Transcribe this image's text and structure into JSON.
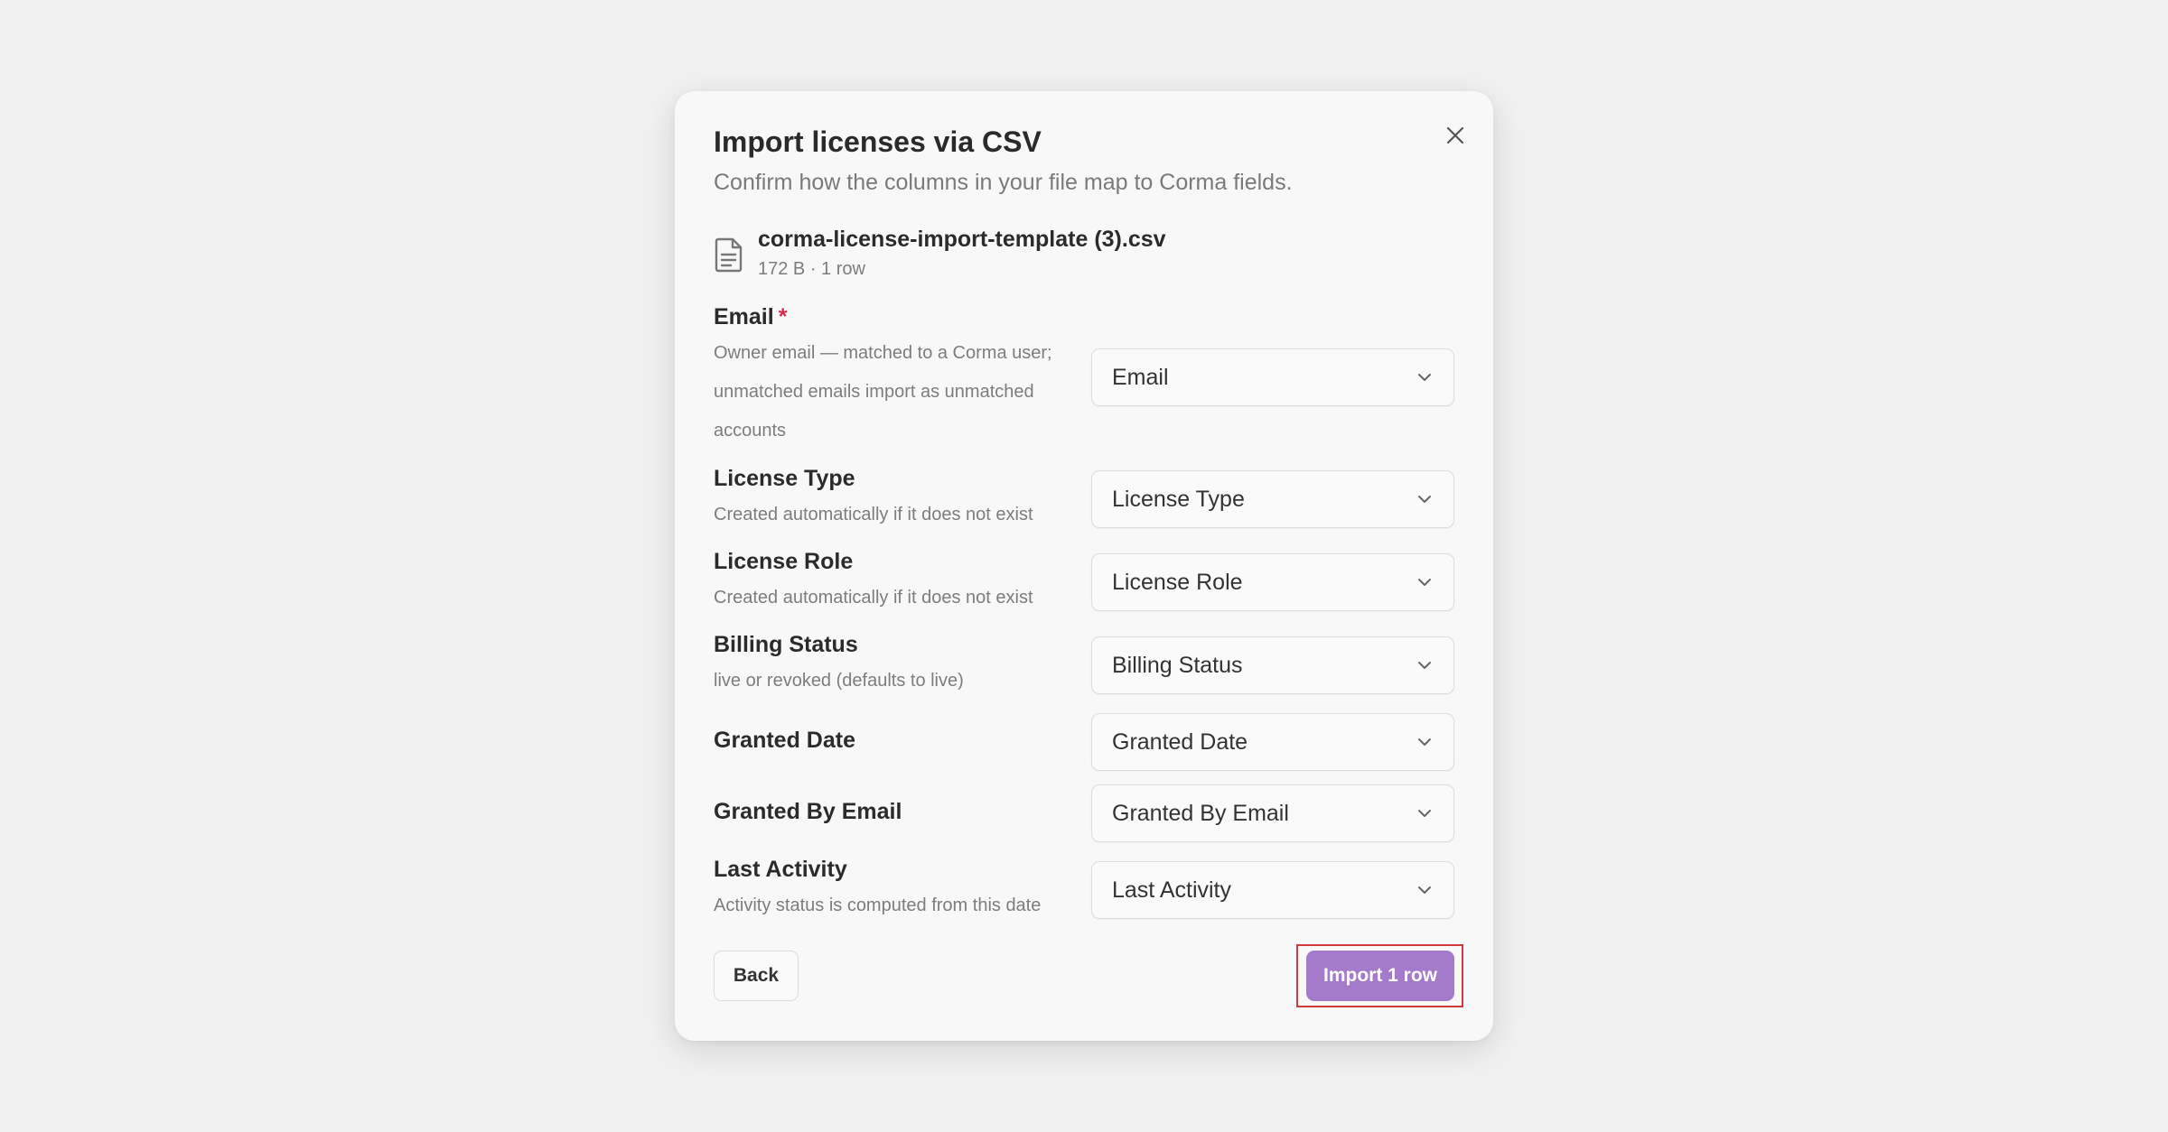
{
  "dialog": {
    "title": "Import licenses via CSV",
    "subtitle": "Confirm how the columns in your file map to Corma fields.",
    "close_icon": "close-icon"
  },
  "file": {
    "icon": "file-text-icon",
    "name": "corma-license-import-template (3).csv",
    "meta": "172 B · 1 row"
  },
  "fields": {
    "email": {
      "label": "Email",
      "required_mark": "*",
      "description": "Owner email — matched to a Corma user; unmatched emails import as unmatched accounts",
      "selected": "Email"
    },
    "license_type": {
      "label": "License Type",
      "description": "Created automatically if it does not exist",
      "selected": "License Type"
    },
    "license_role": {
      "label": "License Role",
      "description": "Created automatically if it does not exist",
      "selected": "License Role"
    },
    "billing_status": {
      "label": "Billing Status",
      "description": "live or revoked (defaults to live)",
      "selected": "Billing Status"
    },
    "granted_date": {
      "label": "Granted Date",
      "selected": "Granted Date"
    },
    "granted_by_email": {
      "label": "Granted By Email",
      "selected": "Granted By Email"
    },
    "last_activity": {
      "label": "Last Activity",
      "description": "Activity status is computed from this date",
      "selected": "Last Activity"
    }
  },
  "footer": {
    "back_label": "Back",
    "import_label": "Import 1 row"
  },
  "colors": {
    "primary": "#a37bca",
    "required": "#d92b4b",
    "focus_ring": "#d03a3a"
  }
}
